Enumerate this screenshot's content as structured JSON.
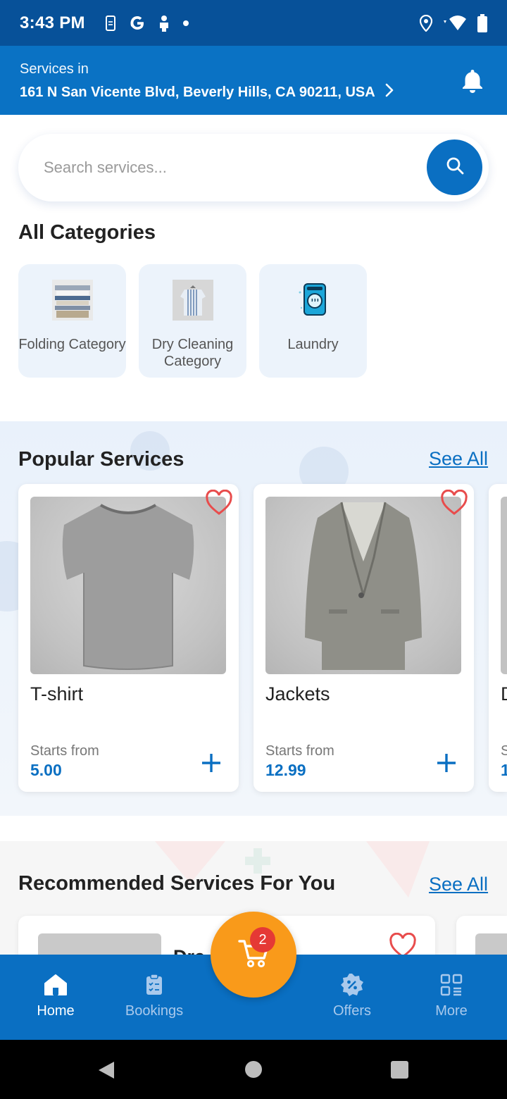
{
  "status_bar": {
    "time": "3:43 PM",
    "left_icons": [
      "phone-notification-icon",
      "google-g-icon",
      "person-icon",
      "dot-icon"
    ],
    "right_icons": [
      "location-icon",
      "wifi-icon",
      "battery-icon"
    ]
  },
  "header": {
    "label": "Services in",
    "address": "161 N San Vicente Blvd, Beverly Hills, CA 90211, USA",
    "chevron_icon": "chevron-right-icon",
    "bell_icon": "bell-icon"
  },
  "search": {
    "placeholder": "Search services...",
    "button_icon": "search-icon"
  },
  "categories": {
    "title": "All Categories",
    "items": [
      {
        "label": "Folding Category",
        "icon": "folded-clothes-image"
      },
      {
        "label": "Dry Cleaning Category",
        "icon": "hanging-shirt-image"
      },
      {
        "label": "Laundry",
        "icon": "washing-machine-icon"
      }
    ]
  },
  "popular": {
    "title": "Popular Services",
    "see_all": "See All",
    "items": [
      {
        "name": "T-shirt",
        "from_label": "Starts from",
        "price": "5.00",
        "image": "tshirt-image"
      },
      {
        "name": "Jackets",
        "from_label": "Starts from",
        "price": "12.99",
        "image": "jacket-image"
      },
      {
        "name": "D",
        "from_label": "S",
        "price": "1",
        "image": "partial-image"
      }
    ]
  },
  "recommended": {
    "title": "Recommended Services For You",
    "see_all": "See All",
    "first_item_partial": "Dre"
  },
  "cart": {
    "count": "2"
  },
  "bottom_nav": {
    "items": [
      {
        "label": "Home",
        "icon": "home-icon",
        "active": true
      },
      {
        "label": "Bookings",
        "icon": "clipboard-icon",
        "active": false
      },
      {
        "label": "Offers",
        "icon": "discount-badge-icon",
        "active": false
      },
      {
        "label": "More",
        "icon": "grid-more-icon",
        "active": false
      }
    ]
  },
  "colors": {
    "status_bar": "#075199",
    "header": "#0a72c4",
    "accent": "#0a6fc2",
    "cart": "#f99a1a",
    "badge": "#e53935",
    "favorite": "#e84c4c"
  }
}
